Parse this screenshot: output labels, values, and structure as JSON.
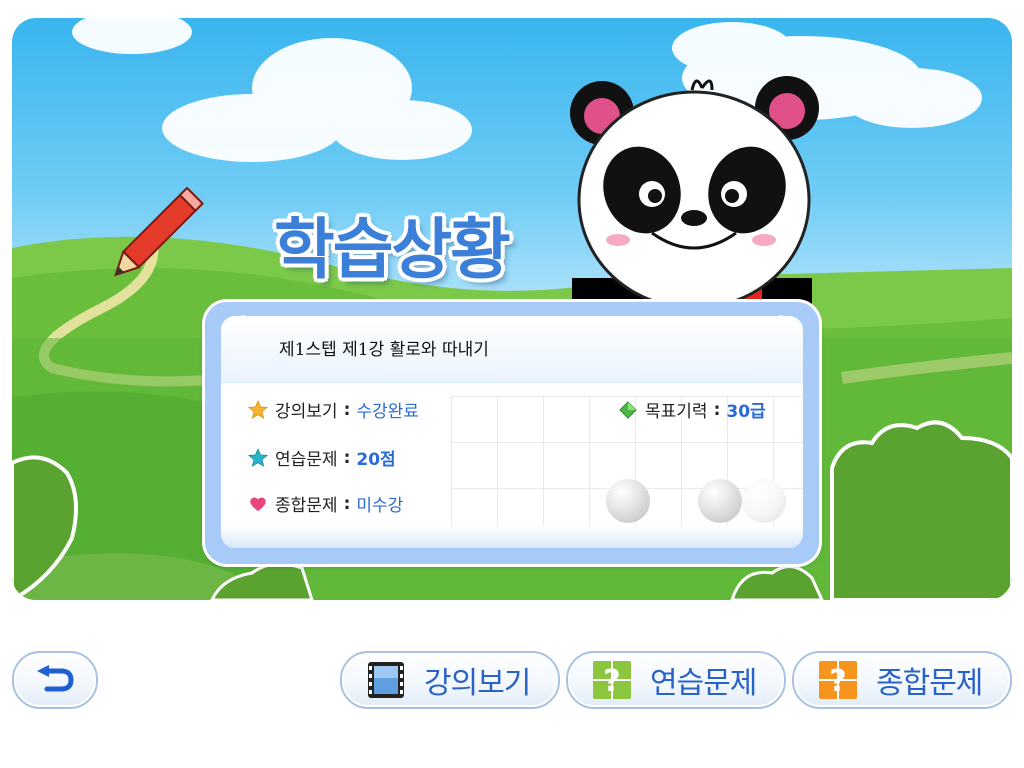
{
  "title": "학습상황",
  "lesson": {
    "name": "제1스텝 제1강 활로와 따내기"
  },
  "status": {
    "lecture": {
      "label": "강의보기",
      "value": "수강완료",
      "icon": "star-icon",
      "color": "#f7b52b"
    },
    "practice": {
      "label": "연습문제",
      "value": "20점",
      "icon": "teal-star-icon",
      "color": "#2ab4c9"
    },
    "comprehensive": {
      "label": "종합문제",
      "value": "미수강",
      "icon": "heart-icon",
      "color": "#e8467c"
    },
    "goal": {
      "label": "목표기력",
      "value": "30급",
      "icon": "green-diamond-icon",
      "color": "#4cb848"
    },
    "separator": ":"
  },
  "buttons": {
    "back": {
      "icon": "back-arrow-icon"
    },
    "lecture": {
      "label": "강의보기",
      "icon": "film-icon"
    },
    "practice": {
      "label": "연습문제",
      "icon": "green-question-icon",
      "color": "#8cc63f"
    },
    "comprehensive": {
      "label": "종합문제",
      "icon": "orange-question-icon",
      "color": "#f7941d"
    }
  },
  "colors": {
    "accent": "#2a63c8",
    "title": "#3b7fd8",
    "value": "#2a6ad9",
    "card_border": "#a8caf6"
  }
}
